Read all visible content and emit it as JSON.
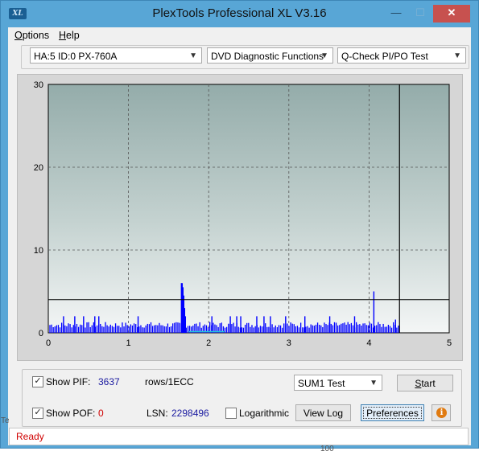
{
  "window": {
    "title": "PlexTools Professional XL V3.16",
    "icon_text": "XL",
    "controls": {
      "minimize": "—",
      "maximize": "☐",
      "close": "✕"
    }
  },
  "menu": [
    {
      "label_underlined": "O",
      "label_rest": "ptions"
    },
    {
      "label_underlined": "H",
      "label_rest": "elp"
    }
  ],
  "toolbar": {
    "drive": "HA:5 ID:0  PX-760A",
    "function": "DVD Diagnostic Functions",
    "test": "Q-Check PI/PO Test"
  },
  "chart_data": {
    "type": "bar",
    "xlim": [
      0,
      5
    ],
    "ylim": [
      0,
      30
    ],
    "x_ticks": [
      "0",
      "1",
      "2",
      "3",
      "4",
      "5"
    ],
    "y_ticks": [
      "0",
      "10",
      "20",
      "30"
    ],
    "threshold_line": 4,
    "end_marker_x": 4.38,
    "grid": true,
    "series_color": "#0000ff",
    "spikes": [
      {
        "x": 1.66,
        "y": 6
      },
      {
        "x": 1.67,
        "y": 6
      },
      {
        "x": 1.68,
        "y": 5.5
      },
      {
        "x": 1.69,
        "y": 4.5
      },
      {
        "x": 1.7,
        "y": 3
      },
      {
        "x": 1.71,
        "y": 2
      },
      {
        "x": 4.06,
        "y": 5
      },
      {
        "x": 0.19,
        "y": 2
      },
      {
        "x": 0.33,
        "y": 2
      },
      {
        "x": 0.44,
        "y": 2
      },
      {
        "x": 0.58,
        "y": 2
      },
      {
        "x": 0.63,
        "y": 2
      },
      {
        "x": 1.12,
        "y": 2
      },
      {
        "x": 2.04,
        "y": 2
      },
      {
        "x": 2.27,
        "y": 2
      },
      {
        "x": 2.35,
        "y": 2
      },
      {
        "x": 2.4,
        "y": 2
      },
      {
        "x": 2.6,
        "y": 2
      },
      {
        "x": 2.69,
        "y": 2
      },
      {
        "x": 2.77,
        "y": 2
      },
      {
        "x": 2.96,
        "y": 2
      },
      {
        "x": 3.2,
        "y": 2
      },
      {
        "x": 3.51,
        "y": 2
      },
      {
        "x": 3.82,
        "y": 2
      },
      {
        "x": 4.33,
        "y": 1.6
      }
    ]
  },
  "controls": {
    "show_pif_label": "Show PIF:",
    "pif_value": "3637",
    "pif_unit": "rows/1ECC",
    "show_pof_label": "Show POF:",
    "pof_value": "0",
    "lsn_label": "LSN:",
    "lsn_value": "2298496",
    "logarithmic_label": "Logarithmic",
    "sum_select": "SUM1 Test",
    "start_label_underlined": "S",
    "start_label_rest": "tart",
    "view_log": "View Log",
    "preferences": "Preferences",
    "info_icon_glyph": "i"
  },
  "status": {
    "text": "Ready"
  },
  "background_fragments": [
    "Te",
    "100"
  ]
}
